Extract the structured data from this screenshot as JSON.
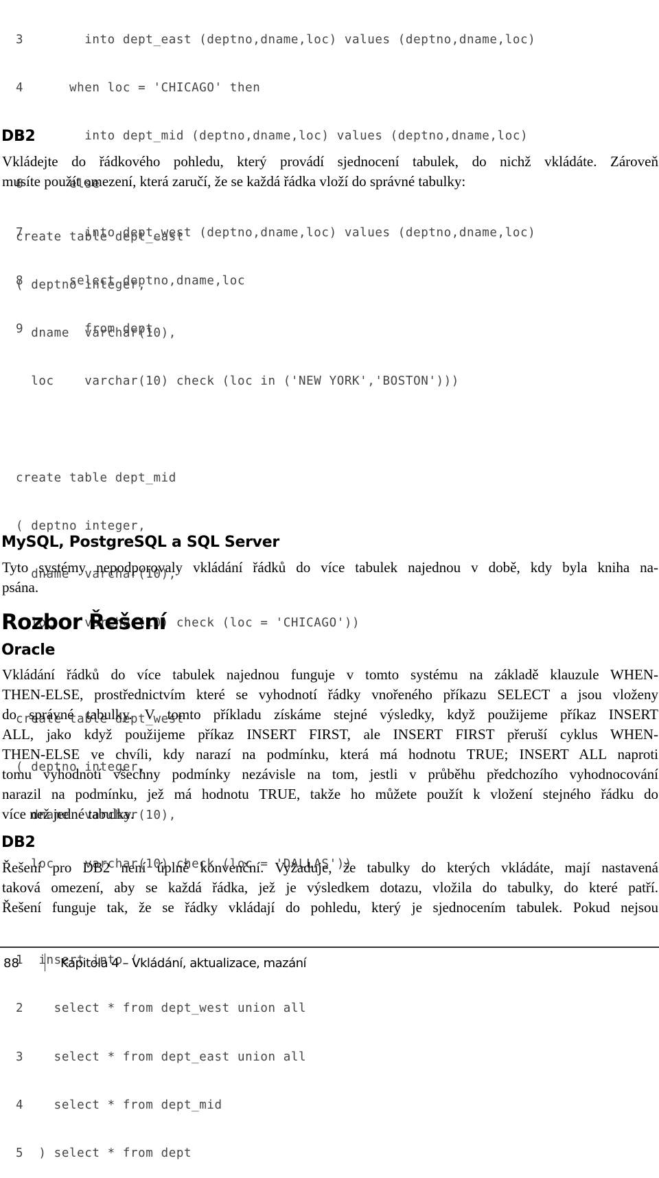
{
  "code_block_1": {
    "lines": [
      "3        into dept_east (deptno,dname,loc) values (deptno,dname,loc)",
      "4      when loc = 'CHICAGO' then",
      "5        into dept_mid (deptno,dname,loc) values (deptno,dname,loc)",
      "6      else",
      "7        into dept_west (deptno,dname,loc) values (deptno,dname,loc)",
      "8      select deptno,dname,loc",
      "9        from dept"
    ]
  },
  "section_db2_problem": {
    "heading": "DB2",
    "paragraph_lines": [
      "Vkládejte do řádkového pohledu, který provádí sjednocení tabulek, do nichž vkládáte. Zároveň",
      "musíte použít omezení, která zaručí, že se každá řádka vloží do správné tabulky:"
    ]
  },
  "code_block_2": {
    "lines": [
      "create table dept_east",
      "( deptno integer,",
      "  dname  varchar(10),",
      "  loc    varchar(10) check (loc in ('NEW YORK','BOSTON')))",
      "",
      "create table dept_mid",
      "( deptno integer,",
      "  dname  varchar(10),",
      "  loc    varchar(10) check (loc = 'CHICAGO'))",
      "",
      "create table dept_west",
      "( deptno integer,",
      "  dname  varchar(10),",
      "  loc    varchar(10) check (loc = 'DALLAS'))",
      "",
      "1  insert into (",
      "2    select * from dept_west union all",
      "3    select * from dept_east union all",
      "4    select * from dept_mid",
      "5  ) select * from dept"
    ]
  },
  "section_others": {
    "heading": "MySQL, PostgreSQL a SQL Server",
    "paragraph_lines": [
      "Tyto systémy nepodporovaly vkládání řádků do více tabulek najednou v době, kdy byla kniha na-",
      "psána."
    ]
  },
  "discussion": {
    "heading": "Rozbor Řešení",
    "oracle": {
      "heading": "Oracle",
      "paragraph_lines": [
        "Vkládání řádků do více tabulek najednou funguje v tomto systému na základě klauzule WHEN-",
        "THEN-ELSE, prostřednictvím které se vyhodnotí řádky vnořeného příkazu SELECT a jsou vloženy",
        "do správné tabulky. V tomto příkladu získáme stejné výsledky, když použijeme příkaz INSERT",
        "ALL, jako když použijeme příkaz INSERT FIRST, ale INSERT FIRST přeruší cyklus WHEN-",
        "THEN-ELSE ve chvíli, kdy narazí na podmínku, která má hodnotu TRUE; INSERT ALL naproti",
        "tomu vyhodnotí všechny podmínky nezávisle na tom, jestli v průběhu předchozího vyhodnocování",
        "narazil na podmínku, jež má hodnotu TRUE, takže ho můžete použít k vložení stejného řádku do",
        "více než jedné tabulky."
      ]
    },
    "db2": {
      "heading": "DB2",
      "paragraph_lines": [
        "Řešení pro DB2 není úplně konvenční. Vyžaduje, že tabulky do kterých vkládáte, mají nastavená",
        "taková omezení, aby se každá řádka, jež je výsledkem dotazu, vložila do tabulky, do které patří.",
        "Řešení funguje tak, že se řádky vkládají do pohledu, který je sjednocením tabulek. Pokud nejsou"
      ]
    }
  },
  "footer": {
    "page_number": "88",
    "chapter": "Kapitola 4 – Vkládání, aktualizace, mazání"
  }
}
